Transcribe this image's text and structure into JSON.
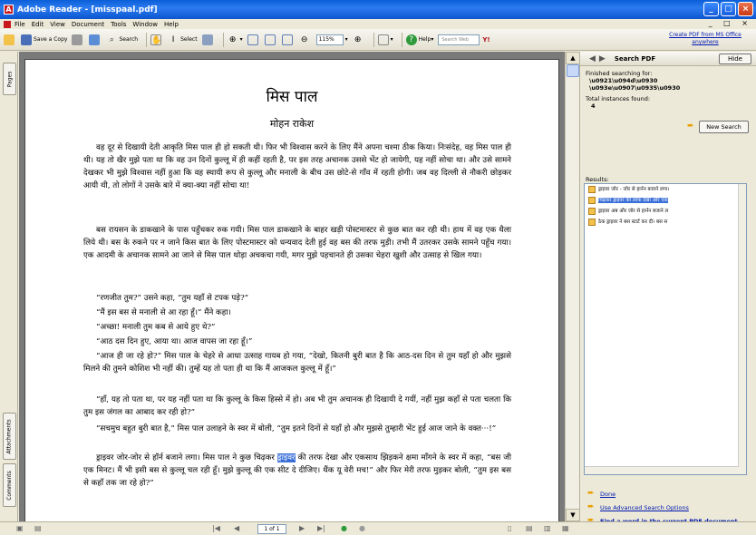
{
  "window": {
    "title": "Adobe Reader - [misspaal.pdf]"
  },
  "menu": {
    "items": [
      "File",
      "Edit",
      "View",
      "Document",
      "Tools",
      "Window",
      "Help"
    ]
  },
  "toolbar": {
    "save_copy": "Save a Copy",
    "search": "Search",
    "select": "Select",
    "zoom": "115%",
    "help": "Help",
    "search_web": "Search Web",
    "create_pdf": "Create PDF from MS Office anywhere"
  },
  "left_tabs": {
    "pages": "Pages",
    "attachments": "Attachments",
    "comments": "Comments"
  },
  "document": {
    "title": "मिस पाल",
    "author": "मोहन राकेश",
    "paragraphs": [
      "वह दूर से दिखायी देती आकृति मिस पाल ही हो सकती थी। फिर भी विश्वास करने के लिए मैंने अपना चश्मा ठीक किया। निःसंदेह, वह मिस पाल ही थी। यह तो खैर मुझे पता था कि वह उन दिनों कुल्लू में ही कहीं रहती है, पर इस तरह अचानक उससे भेंट हो जायेगी, यह नहीं सोचा था। और उसे सामने देखकर भी मुझे विश्वास नहीं हुआ कि वह स्थायी रूप से कुल्लू और मनाली के बीच उस छोटे-से गाँव में रहती होगी। जब वह दिल्ली से नौकरी छोड़कर आयी थी, तो लोगों ने उसके बारे में क्या-क्या नहीं सोचा था!",
      "बस रायसन के डाकखाने के पास पहुँचकर रुक गयी। मिस पाल डाकखाने के बाहर खड़ी पोस्टमास्टर से कुछ बात कर रही थी। हाथ में वह एक थैला लिये थी। बस के रुकने पर न जाने किस बात के लिए पोस्टमास्टर को धन्यवाद देती हुई वह बस की तरफ मुड़ी। तभी मैं उतरकर उसके सामने पहुँच गया। एक आदमी के अचानक सामने आ जाने से मिस पाल थोड़ा अचकचा गयी, मगर मुझे पहचानते ही उसका चेहरा खुशी और उत्साह से खिल गया।",
      "“रणजीत तुम?” उसने कहा, “तुम यहाँ से टपक पड़े?”",
      "“मैं इस बस से मनाली से आ रहा हूँ।” मैंने कहा।",
      "“अच्छा! मनाली तुम कब से आये हुए थे?”",
      "“आठ दस दिन हुए, आया था। आज वापस जा रहा हूँ।”",
      "“आज ही जा रहे हो?” मिस पाल के चेहरे से आधा उत्साह गायब हो गया, “देखो, कितनी बुरी बात है कि आठ-दस दिन से तुम यहाँ हो और मुझसे मिलने की तुमने कोशिश भी नहीं की। तुम्हें यह तो पता ही था कि मैं आजकल कुल्लू में हूँ।”",
      "“हाँ, यह तो पता था, पर यह नहीं पता था कि कुल्लू के किस हिस्से में हो। अब भी तुम अचानक ही दिखायी दे गयीं, नहीं मुझ कहाँ से पता चलता कि तुम इस जंगल का आबाद कर रही हो?”",
      "“सचमुच बहुत बुरी बात है,” मिस पाल उलाहने के स्वर में बोली, “तुम इतने दिनों से यहाँ हो और मुझसे तुम्हारी भेंट हुई आज जाने के वक्त···!”"
    ],
    "last_para": {
      "before": "ड्राइवर जोर-जोर से हॉर्न बजाने लगा। मिस पाल ने कुछ चिढ़कर ",
      "highlight": "ड्राइवर",
      "after": " की तरफ देखा और एकसाथ झिड़कने क्षमा माँगने के स्वर में कहा, “बस जी एक मिनट। मैं भी इसी बस से कुल्लू चल रही हूँ। मुझे कुल्लू की एक सीट दे दीजिए। थैंक यू वेरी मच!” और फिर मेरी तरफ मुड़कर बोली, “तुम इस बस से कहाँ तक जा रहे हो?”"
    }
  },
  "search_panel": {
    "title": "Search PDF",
    "hide": "Hide",
    "finished_label": "Finished searching for:",
    "query_line1": "\\u0921\\u094d\\u0930",
    "query_line2": "\\u093e\\u0907\\u0935\\u0930",
    "total_label": "Total instances found:",
    "total_count": "4",
    "new_search": "New Search",
    "results_label": "Results:",
    "results": [
      {
        "text": "ड्राइवर जोर - जोर से हार्नन बजाने लगा।"
      },
      {
        "text": "चिढ़कर ड्राइवर की तरफ देखा और एक"
      },
      {
        "text": "ड्राइवर अब और जोर से हार्नन बजाने ल"
      },
      {
        "text": "ठेक ड्राइवर ने बस स्टार्ट कर दी। बस स"
      }
    ],
    "links": {
      "done": "Done",
      "advanced": "Use Advanced Search Options",
      "find_word": "Find a word in the current PDF document"
    }
  },
  "status": {
    "page": "1 of 1"
  }
}
